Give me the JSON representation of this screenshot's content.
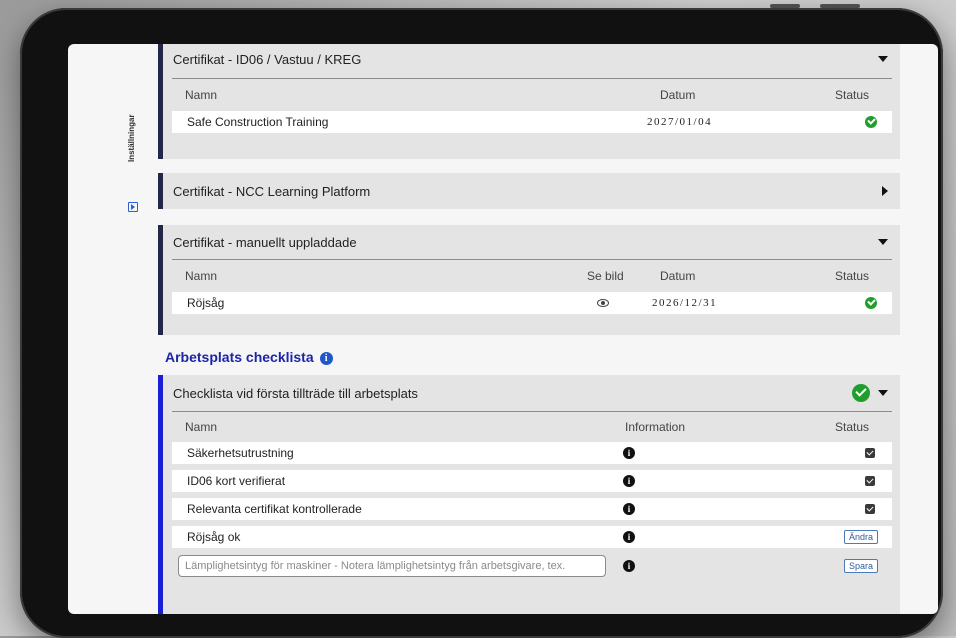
{
  "sidebar": {
    "label": "Inställningar",
    "icon": "play-square-icon"
  },
  "panels": {
    "id06": {
      "title": "Certifikat - ID06 / Vastuu / KREG",
      "columns": {
        "name": "Namn",
        "date": "Datum",
        "status": "Status"
      },
      "rows": [
        {
          "name": "Safe Construction Training",
          "date": "2027/01/04",
          "status": "ok"
        }
      ]
    },
    "ncc": {
      "title": "Certifikat - NCC Learning Platform"
    },
    "manual": {
      "title": "Certifikat - manuellt uppladdade",
      "columns": {
        "name": "Namn",
        "image": "Se bild",
        "date": "Datum",
        "status": "Status"
      },
      "rows": [
        {
          "name": "Röjsåg",
          "date": "2026/12/31",
          "status": "ok"
        }
      ]
    }
  },
  "checklist_section": {
    "title": "Arbetsplats checklista",
    "info_glyph": "i",
    "panel": {
      "title": "Checklista vid första tillträde till arbetsplats",
      "columns": {
        "name": "Namn",
        "information": "Information",
        "status": "Status"
      },
      "rows": [
        {
          "name": "Säkerhetsutrustning",
          "status": "checked"
        },
        {
          "name": "ID06 kort verifierat",
          "status": "checked"
        },
        {
          "name": "Relevanta certifikat kontrollerade",
          "status": "checked"
        },
        {
          "name": "Röjsåg ok",
          "action": "Ändra"
        }
      ],
      "input": {
        "placeholder": "Lämplighetsintyg för maskiner - Notera lämplighetsintyg från arbetsgivare, tex.",
        "value": "",
        "action": "Spara"
      }
    }
  },
  "colors": {
    "accent_dark": "#232849",
    "accent_blue": "#1a1fd6",
    "ok_green": "#1f9e2c",
    "title_blue": "#1d25a6"
  }
}
